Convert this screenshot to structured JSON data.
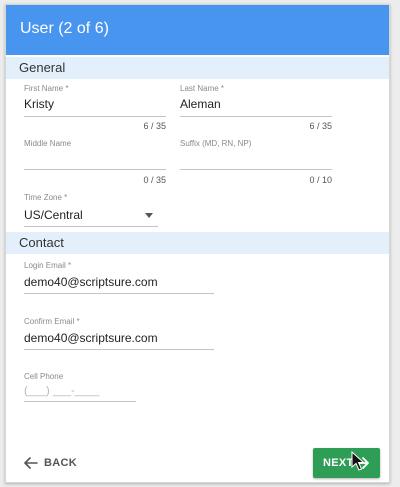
{
  "header": {
    "title": "User (2 of 6)"
  },
  "sections": {
    "general": "General",
    "contact": "Contact"
  },
  "fields": {
    "first_name": {
      "label": "First Name *",
      "value": "Kristy",
      "counter": "6 / 35"
    },
    "last_name": {
      "label": "Last Name *",
      "value": "Aleman",
      "counter": "6 / 35"
    },
    "middle_name": {
      "label": "Middle Name",
      "value": "",
      "counter": "0 / 35"
    },
    "suffix": {
      "label": "Suffix (MD, RN, NP)",
      "value": "",
      "counter": "0 / 10"
    },
    "time_zone": {
      "label": "Time Zone *",
      "value": "US/Central"
    },
    "login_email": {
      "label": "Login Email *",
      "value": "demo40@scriptsure.com"
    },
    "confirm_email": {
      "label": "Confirm Email *",
      "value": "demo40@scriptsure.com"
    },
    "cell_phone": {
      "label": "Cell Phone",
      "placeholder": "(___) ___-____"
    }
  },
  "actions": {
    "back_label": "BACK",
    "next_label": "NEXT"
  },
  "colors": {
    "header": "#4795ee",
    "section": "#e3f0fb",
    "next_button": "#2e9d55"
  }
}
